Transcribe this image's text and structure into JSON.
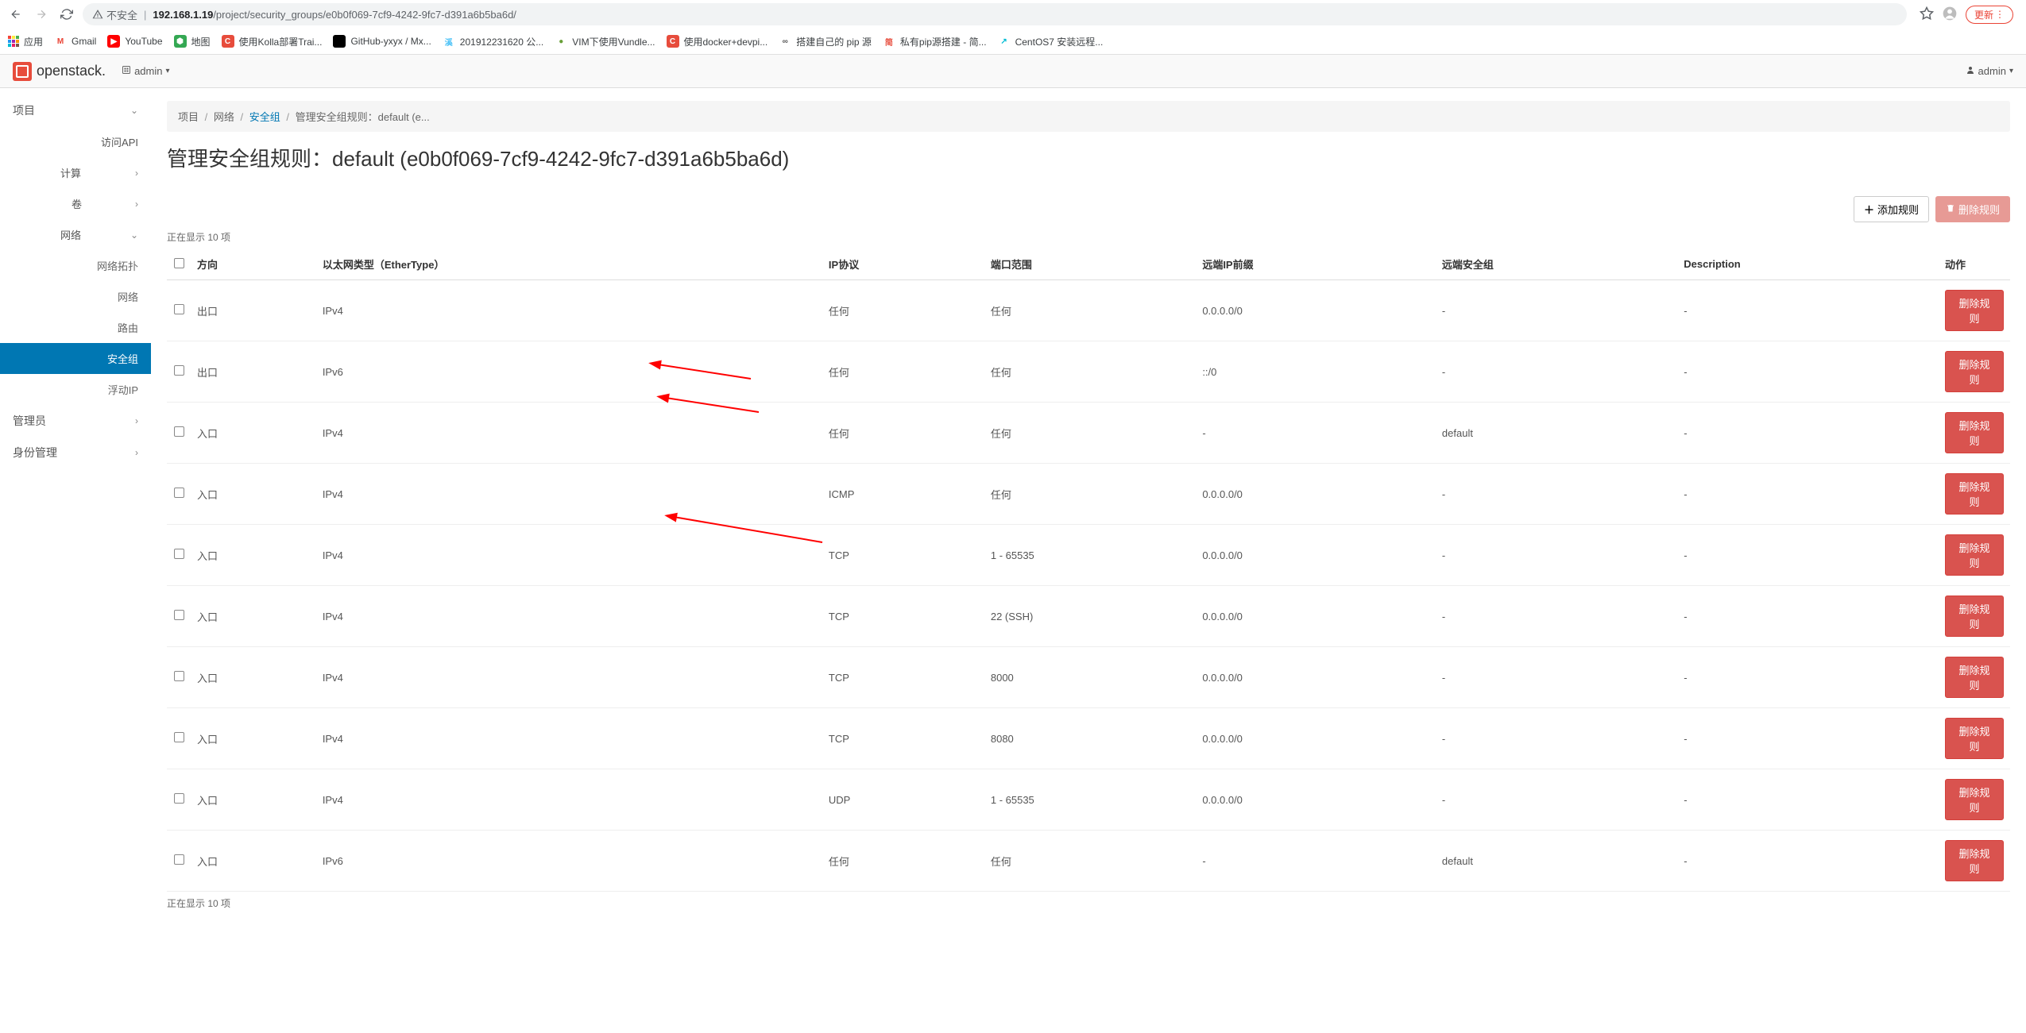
{
  "browser": {
    "insecure_label": "不安全",
    "url_host": "192.168.1.19",
    "url_path": "/project/security_groups/e0b0f069-7cf9-4242-9fc7-d391a6b5ba6d/",
    "update_label": "更新",
    "apps_label": "应用",
    "bookmarks": [
      {
        "label": "Gmail",
        "icon": "M",
        "bg": "#fff",
        "fg": "#ea4335"
      },
      {
        "label": "YouTube",
        "icon": "▶",
        "bg": "#ff0000",
        "fg": "#fff"
      },
      {
        "label": "地图",
        "icon": "⬢",
        "bg": "#34a853",
        "fg": "#fff"
      },
      {
        "label": "使用Kolla部署Trai...",
        "icon": "C",
        "bg": "#e74c3c",
        "fg": "#fff"
      },
      {
        "label": "GitHub-yxyx / Mx...",
        "icon": "",
        "bg": "#000",
        "fg": "#fff"
      },
      {
        "label": "201912231620 公...",
        "icon": "溪",
        "bg": "#fff",
        "fg": "#4fc3f7"
      },
      {
        "label": "VIM下使用Vundle...",
        "icon": "●",
        "bg": "#fff",
        "fg": "#689f38"
      },
      {
        "label": "使用docker+devpi...",
        "icon": "C",
        "bg": "#e74c3c",
        "fg": "#fff"
      },
      {
        "label": "搭建自己的 pip 源",
        "icon": "∞",
        "bg": "#fff",
        "fg": "#555"
      },
      {
        "label": "私有pip源搭建 - 简...",
        "icon": "简",
        "bg": "#fff",
        "fg": "#e74c3c"
      },
      {
        "label": "CentOS7 安装远程...",
        "icon": "↗",
        "bg": "#fff",
        "fg": "#00bcd4"
      }
    ]
  },
  "header": {
    "brand": "openstack.",
    "project_selector_label": "admin",
    "user_label": "admin"
  },
  "sidebar": {
    "project": "项目",
    "api_access": "访问API",
    "compute": "计算",
    "volumes": "卷",
    "network": "网络",
    "network_topology": "网络拓扑",
    "networks": "网络",
    "routers": "路由",
    "security_groups": "安全组",
    "floating_ips": "浮动IP",
    "admin": "管理员",
    "identity": "身份管理"
  },
  "breadcrumb": {
    "project": "项目",
    "network": "网络",
    "security_groups": "安全组",
    "current": "管理安全组规则：default (e..."
  },
  "page": {
    "title": "管理安全组规则：default (e0b0f069-7cf9-4242-9fc7-d391a6b5ba6d)",
    "add_rule": "添加规则",
    "delete_rules": "删除规则",
    "showing_top": "正在显示 10 项",
    "showing_bottom": "正在显示 10 项"
  },
  "table": {
    "headers": {
      "direction": "方向",
      "ether_type": "以太网类型（EtherType）",
      "ip_protocol": "IP协议",
      "port_range": "端口范围",
      "remote_ip": "远端IP前缀",
      "remote_sg": "远端安全组",
      "description": "Description",
      "actions": "动作"
    },
    "delete_label": "删除规则",
    "rows": [
      {
        "direction": "出口",
        "ether": "IPv4",
        "proto": "任何",
        "port": "任何",
        "remote_ip": "0.0.0.0/0",
        "remote_sg": "-",
        "desc": "-"
      },
      {
        "direction": "出口",
        "ether": "IPv6",
        "proto": "任何",
        "port": "任何",
        "remote_ip": "::/0",
        "remote_sg": "-",
        "desc": "-"
      },
      {
        "direction": "入口",
        "ether": "IPv4",
        "proto": "任何",
        "port": "任何",
        "remote_ip": "-",
        "remote_sg": "default",
        "desc": "-"
      },
      {
        "direction": "入口",
        "ether": "IPv4",
        "proto": "ICMP",
        "port": "任何",
        "remote_ip": "0.0.0.0/0",
        "remote_sg": "-",
        "desc": "-"
      },
      {
        "direction": "入口",
        "ether": "IPv4",
        "proto": "TCP",
        "port": "1 - 65535",
        "remote_ip": "0.0.0.0/0",
        "remote_sg": "-",
        "desc": "-"
      },
      {
        "direction": "入口",
        "ether": "IPv4",
        "proto": "TCP",
        "port": "22 (SSH)",
        "remote_ip": "0.0.0.0/0",
        "remote_sg": "-",
        "desc": "-"
      },
      {
        "direction": "入口",
        "ether": "IPv4",
        "proto": "TCP",
        "port": "8000",
        "remote_ip": "0.0.0.0/0",
        "remote_sg": "-",
        "desc": "-"
      },
      {
        "direction": "入口",
        "ether": "IPv4",
        "proto": "TCP",
        "port": "8080",
        "remote_ip": "0.0.0.0/0",
        "remote_sg": "-",
        "desc": "-"
      },
      {
        "direction": "入口",
        "ether": "IPv4",
        "proto": "UDP",
        "port": "1 - 65535",
        "remote_ip": "0.0.0.0/0",
        "remote_sg": "-",
        "desc": "-"
      },
      {
        "direction": "入口",
        "ether": "IPv6",
        "proto": "任何",
        "port": "任何",
        "remote_ip": "-",
        "remote_sg": "default",
        "desc": "-"
      }
    ]
  }
}
